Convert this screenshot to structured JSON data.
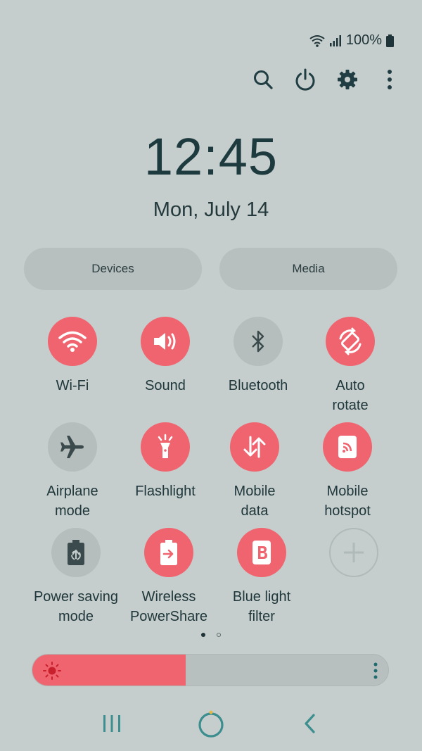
{
  "status_bar": {
    "battery_text": "100%",
    "icons": [
      "wifi-icon",
      "signal-icon",
      "battery-icon"
    ]
  },
  "top_actions": [
    "search-icon",
    "power-icon",
    "settings-icon",
    "more-icon"
  ],
  "clock": {
    "time": "12:45",
    "date": "Mon, July 14"
  },
  "pills": {
    "devices": "Devices",
    "media": "Media"
  },
  "tiles": [
    {
      "id": "wifi",
      "line1": "Wi-Fi",
      "line2": "",
      "state": "on",
      "icon": "wifi-icon"
    },
    {
      "id": "sound",
      "line1": "Sound",
      "line2": "",
      "state": "on",
      "icon": "speaker-icon"
    },
    {
      "id": "bluetooth",
      "line1": "Bluetooth",
      "line2": "",
      "state": "off",
      "icon": "bluetooth-icon"
    },
    {
      "id": "auto-rotate",
      "line1": "Auto",
      "line2": "rotate",
      "state": "on",
      "icon": "rotate-icon"
    },
    {
      "id": "airplane",
      "line1": "Airplane",
      "line2": "mode",
      "state": "off",
      "icon": "airplane-icon"
    },
    {
      "id": "flashlight",
      "line1": "Flashlight",
      "line2": "",
      "state": "on",
      "icon": "flashlight-icon"
    },
    {
      "id": "mobile-data",
      "line1": "Mobile",
      "line2": "data",
      "state": "on",
      "icon": "data-arrows-icon"
    },
    {
      "id": "mobile-hotspot",
      "line1": "Mobile",
      "line2": "hotspot",
      "state": "on",
      "icon": "hotspot-icon"
    },
    {
      "id": "power-saving",
      "line1": "Power saving",
      "line2": "mode",
      "state": "off",
      "icon": "power-saving-icon"
    },
    {
      "id": "wireless-powershare",
      "line1": "Wireless",
      "line2": "PowerShare",
      "state": "on",
      "icon": "powershare-icon"
    },
    {
      "id": "blue-light",
      "line1": "Blue light",
      "line2": "filter",
      "state": "on",
      "icon": "blue-light-icon"
    },
    {
      "id": "add",
      "line1": "",
      "line2": "",
      "state": "add",
      "icon": "add-icon"
    }
  ],
  "page_indicator": {
    "pages": 2,
    "current": 1
  },
  "brightness": {
    "level": 0.43,
    "icon": "sun-icon"
  },
  "nav_bar": [
    "recents-icon",
    "home-icon",
    "back-icon"
  ],
  "colors": {
    "accent": "#f06470",
    "background": "#c5cecc",
    "inactive_tile": "#b5bebc",
    "text": "#1f3438"
  }
}
